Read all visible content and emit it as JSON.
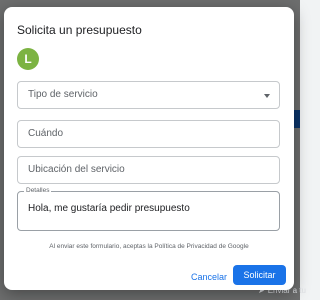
{
  "dialog": {
    "title": "Solicita un presupuesto",
    "avatar_letter": "L",
    "avatar_color": "#7cb342",
    "fields": {
      "service": {
        "placeholder": "Tipo de servicio",
        "icon": "dropdown-arrow-icon"
      },
      "when": {
        "placeholder": "Cuándo"
      },
      "location": {
        "placeholder": "Ubicación del servicio"
      },
      "details": {
        "label": "Detalles",
        "value": "Hola, me gustaría pedir presupuesto"
      }
    },
    "privacy_text": "Al enviar este formulario, aceptas la Política de Privacidad de Google",
    "buttons": {
      "cancel": "Cancelar",
      "submit": "Solicitar"
    }
  },
  "background": {
    "bottom_text": "Enviar a tu",
    "icon": "send-icon"
  },
  "colors": {
    "accent": "#1a73e8",
    "overlay": "rgba(0,0,0,0.55)"
  }
}
